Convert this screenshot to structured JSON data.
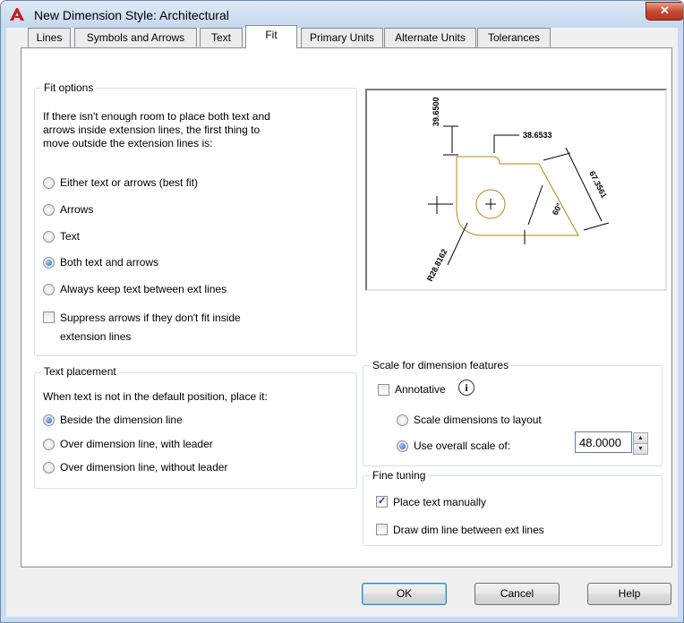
{
  "window": {
    "title": "New Dimension Style: Architectural",
    "close_label": "✕"
  },
  "tabs": [
    {
      "label": "Lines"
    },
    {
      "label": "Symbols and Arrows"
    },
    {
      "label": "Text"
    },
    {
      "label": "Fit",
      "active": true
    },
    {
      "label": "Primary Units"
    },
    {
      "label": "Alternate Units"
    },
    {
      "label": "Tolerances"
    }
  ],
  "fit_options": {
    "legend": "Fit options",
    "description": [
      "If there isn't enough room to place both text and",
      "arrows inside extension lines, the first thing to",
      "move outside the extension lines is:"
    ],
    "options": [
      {
        "label": "Either text or arrows (best fit)",
        "selected": false
      },
      {
        "label": "Arrows",
        "selected": false
      },
      {
        "label": "Text",
        "selected": false
      },
      {
        "label": "Both text and arrows",
        "selected": true
      },
      {
        "label": "Always keep text between ext lines",
        "selected": false
      }
    ],
    "suppress": {
      "label_line1": "Suppress arrows if they don't fit inside",
      "label_line2": "extension lines",
      "checked": false
    }
  },
  "text_placement": {
    "legend": "Text placement",
    "description": "When text is not in the default position, place it:",
    "options": [
      {
        "label": "Beside the dimension line",
        "selected": true
      },
      {
        "label": "Over dimension line, with leader",
        "selected": false
      },
      {
        "label": "Over dimension line, without leader",
        "selected": false
      }
    ]
  },
  "preview": {
    "labels": {
      "dim_top_vertical": "39.6500",
      "dim_top_right": "38.6533",
      "dim_slanted": "67.3561",
      "dim_angle": "60°",
      "dim_radius": "R28.8162"
    },
    "colors": {
      "outline": "#b8860b",
      "lines": "#000000"
    }
  },
  "scale": {
    "legend": "Scale for dimension features",
    "annotative": {
      "label": "Annotative",
      "checked": false,
      "icon": "info-icon"
    },
    "scale_to_layout": {
      "label": "Scale dimensions to layout",
      "selected": false
    },
    "use_overall": {
      "label": "Use overall scale of:",
      "selected": true
    },
    "overall_value": "48.0000"
  },
  "fine_tuning": {
    "legend": "Fine tuning",
    "place_text_manually": {
      "label": "Place text manually",
      "checked": true
    },
    "draw_dim_line": {
      "label": "Draw dim line between ext lines",
      "checked": false
    }
  },
  "buttons": {
    "ok": "OK",
    "cancel": "Cancel",
    "help": "Help"
  },
  "colors": {
    "title_bar": "#c9dcf0",
    "close_button": "#c7452d",
    "panel": "#ffffff",
    "radio_selected": "#1a5fb4"
  }
}
